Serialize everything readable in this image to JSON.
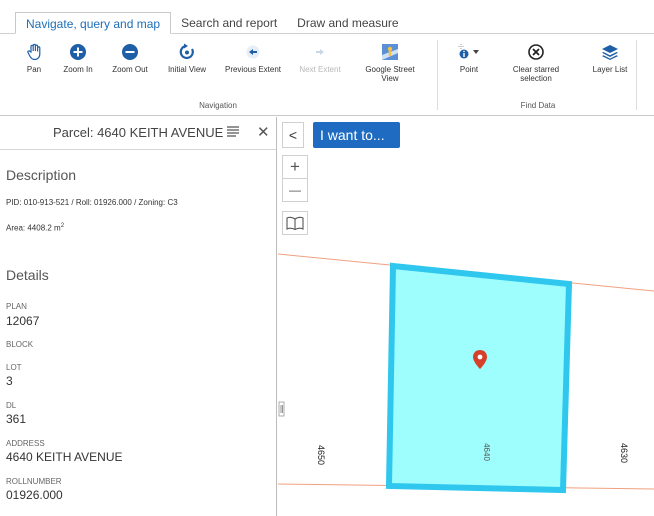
{
  "tabs": [
    {
      "label": "Navigate, query and map",
      "active": true
    },
    {
      "label": "Search and report",
      "active": false
    },
    {
      "label": "Draw and measure",
      "active": false
    }
  ],
  "navigation_group": {
    "label": "Navigation",
    "tools": [
      {
        "label": "Pan",
        "icon": "hand-icon",
        "enabled": true
      },
      {
        "label": "Zoom In",
        "icon": "zoom-in-icon",
        "enabled": true
      },
      {
        "label": "Zoom Out",
        "icon": "zoom-out-icon",
        "enabled": true
      },
      {
        "label": "Initial View",
        "icon": "initial-view-icon",
        "enabled": true
      },
      {
        "label": "Previous Extent",
        "icon": "previous-extent-icon",
        "enabled": true
      },
      {
        "label": "Next Extent",
        "icon": "next-extent-icon",
        "enabled": false
      },
      {
        "label_line1": "Google Street",
        "label_line2": "View",
        "icon": "street-view-icon",
        "enabled": true
      }
    ]
  },
  "find_data_group": {
    "label": "Find Data",
    "tools": [
      {
        "label": "Point",
        "icon": "identify-point-icon",
        "enabled": true
      },
      {
        "label_line1": "Clear starred",
        "label_line2": "selection",
        "icon": "clear-selection-icon",
        "enabled": true
      },
      {
        "label": "Layer List",
        "icon": "layers-icon",
        "enabled": true
      }
    ]
  },
  "panel": {
    "title": "Parcel: 4640 KEITH AVENUE",
    "description_heading": "Description",
    "description_line": "PID: 010-913-521 / Roll: 01926.000 / Zoning: C3",
    "area_text": "Area: 4408.2 m",
    "area_unit_sup": "2",
    "details_heading": "Details",
    "fields": [
      {
        "label": "PLAN",
        "value": "12067"
      },
      {
        "label": "BLOCK",
        "value": ""
      },
      {
        "label": "LOT",
        "value": "3"
      },
      {
        "label": "DL",
        "value": "361"
      },
      {
        "label": "ADDRESS",
        "value": "4640 KEITH AVENUE"
      },
      {
        "label": "ROLLNUMBER",
        "value": "01926.000"
      }
    ]
  },
  "map": {
    "back_glyph": "<",
    "i_want_to": "I want to...",
    "zoom_in_glyph": "+",
    "zoom_out_glyph": "—",
    "parcel_labels": [
      "4650",
      "4640",
      "4630"
    ]
  },
  "colors": {
    "accent": "#1e6bc1",
    "tab_active_text": "#1d6fb8",
    "parcel_fill": "#9efefe",
    "parcel_border": "#2fc7ee",
    "property_line": "#f0a080",
    "pin": "#d6402a"
  }
}
